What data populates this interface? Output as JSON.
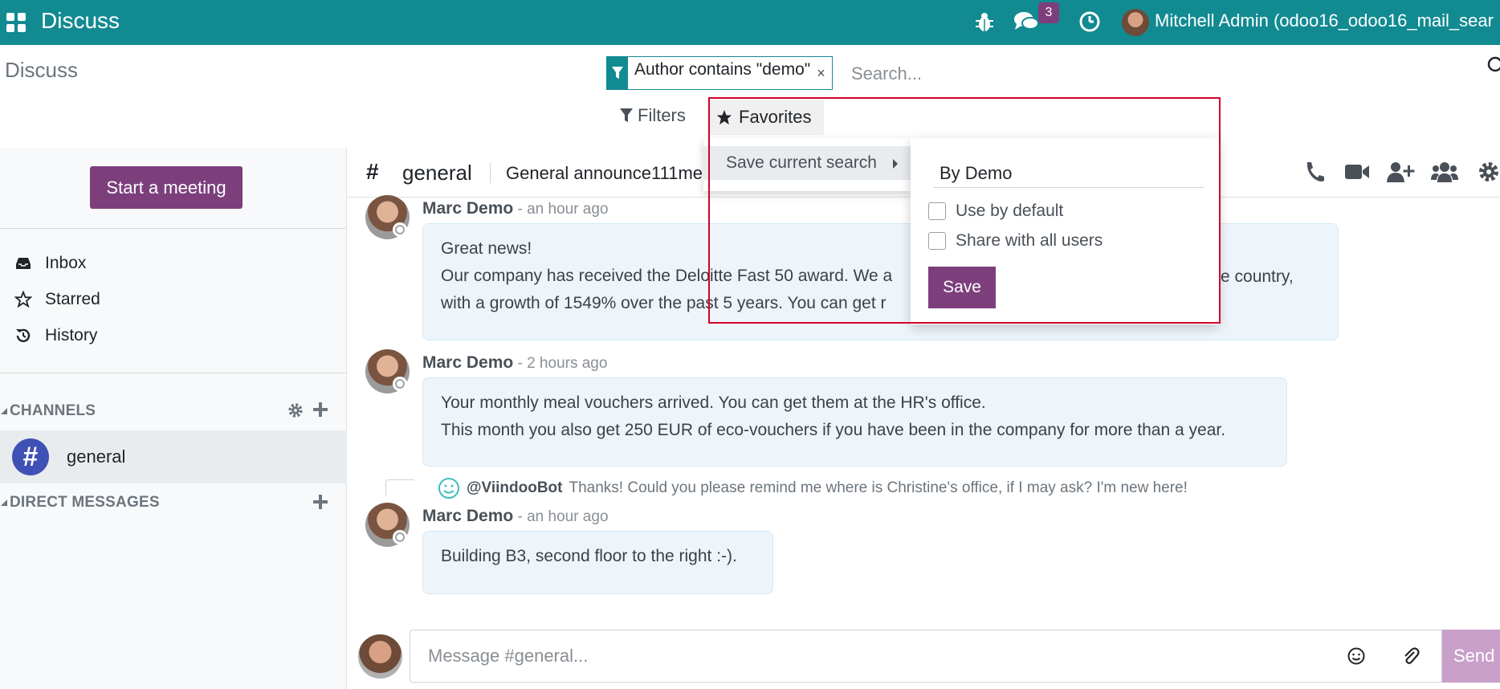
{
  "topbar": {
    "app_name": "Discuss",
    "messages_badge": "3",
    "user_name": "Mitchell Admin (odoo16_odoo16_mail_sear"
  },
  "control_panel": {
    "title": "Discuss",
    "facet_text": "Author contains \"demo\"",
    "facet_close": "×",
    "search_placeholder": "Search...",
    "filters_label": "Filters",
    "favorites_label": "Favorites"
  },
  "favorites_menu": {
    "save_current_search": "Save current search",
    "name_value": "By Demo",
    "use_by_default": "Use by default",
    "share_with_all": "Share with all users",
    "save_label": "Save"
  },
  "sidebar": {
    "start_meeting": "Start a meeting",
    "nav": [
      {
        "label": "Inbox",
        "icon": "inbox-icon"
      },
      {
        "label": "Starred",
        "icon": "star-icon"
      },
      {
        "label": "History",
        "icon": "history-icon"
      }
    ],
    "channels_header": "CHANNELS",
    "channels": [
      {
        "label": "general",
        "avatar": "#"
      }
    ],
    "direct_messages_header": "DIRECT MESSAGES"
  },
  "thread": {
    "hash": "#",
    "name": "general",
    "description": "General announce111me"
  },
  "messages": [
    {
      "author": "Marc Demo",
      "date": " - an hour ago",
      "lines": [
        "Great news!",
        "Our company has received the Deloitte Fast 50 award. We a",
        "with a growth of 1549% over the past 5 years. You can get r"
      ],
      "trailing": "e country,"
    },
    {
      "author": "Marc Demo",
      "date": " - 2 hours ago",
      "lines": [
        "Your monthly meal vouchers arrived. You can get them at the HR's office.",
        "This month you also get 250 EUR of eco-vouchers if you have been in the company for more than a year."
      ]
    },
    {
      "author": "Marc Demo",
      "date": " - an hour ago",
      "reply_author": "@ViindooBot",
      "reply_text": "Thanks! Could you please remind me where is Christine's office, if I may ask? I'm new here!",
      "lines": [
        "Building B3, second floor to the right :-)."
      ]
    }
  ],
  "composer": {
    "placeholder": "Message #general...",
    "send_label": "Send"
  },
  "colors": {
    "topbar": "#128a91",
    "primary": "#7c3f7c",
    "highlight_frame": "#d4002a"
  }
}
